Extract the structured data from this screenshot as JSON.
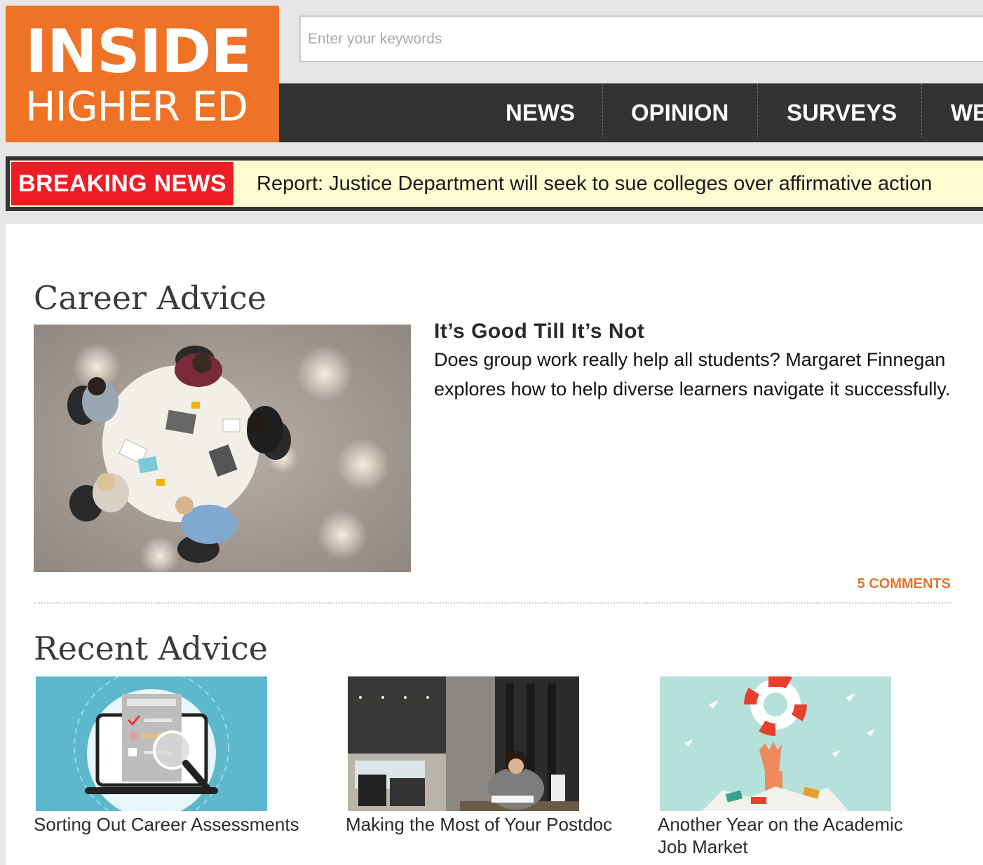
{
  "logo": {
    "line1": "INSIDE",
    "line2": "HIGHER ED",
    "bg": "#ee7326"
  },
  "search": {
    "placeholder": "Enter your keywords",
    "value": ""
  },
  "nav": {
    "items": [
      {
        "label": "NEWS"
      },
      {
        "label": "OPINION"
      },
      {
        "label": "SURVEYS"
      },
      {
        "label": "WE"
      }
    ]
  },
  "breaking": {
    "label": "BREAKING NEWS",
    "headline": "Report: Justice Department will seek to sue colleges over affirmative action",
    "label_color": "#ee1c24",
    "bar_color": "#fdfbd0"
  },
  "career": {
    "title": "Career Advice",
    "feature": {
      "title": "It’s Good Till It’s Not",
      "text": "Does group work really help all students? Margaret Finnegan explores how to help diverse learners navigate it successfully.",
      "comments": "5 COMMENTS"
    }
  },
  "recent": {
    "title": "Recent Advice",
    "items": [
      {
        "title": "Sorting Out Career Assessments"
      },
      {
        "title": "Making the Most of Your Postdoc"
      },
      {
        "title": "Another Year on the Academic Job Market"
      }
    ]
  },
  "colors": {
    "accent": "#e8742a",
    "nav_bg": "#333333"
  }
}
